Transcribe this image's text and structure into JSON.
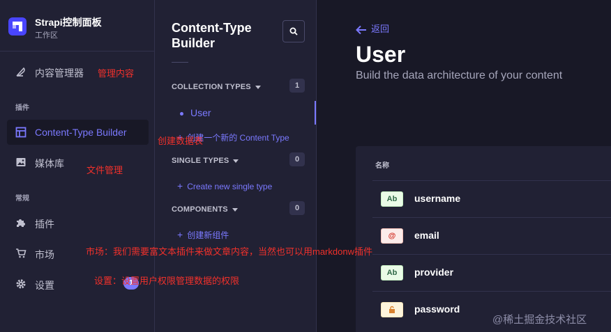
{
  "brand": {
    "title": "Strapi控制面板",
    "subtitle": "工作区"
  },
  "nav": {
    "content_manager": "内容管理器",
    "section_plugins": "插件",
    "content_type_builder": "Content-Type Builder",
    "media_library": "媒体库",
    "section_general": "常规",
    "plugins": "插件",
    "marketplace": "市场",
    "settings": "设置",
    "settings_badge": "1"
  },
  "builder": {
    "title": "Content-Type Builder",
    "collection_types": {
      "label": "COLLECTION TYPES",
      "count": "1",
      "items": [
        "User"
      ],
      "add": "创建一个新的 Content Type"
    },
    "single_types": {
      "label": "SINGLE TYPES",
      "count": "0",
      "add": "Create new single type"
    },
    "components": {
      "label": "COMPONENTS",
      "count": "0",
      "add": "创建新组件"
    }
  },
  "main": {
    "back": "返回",
    "title": "User",
    "subtitle": "Build the data architecture of your content",
    "table_header": "名称",
    "fields": [
      {
        "icon": "Ab",
        "name": "username",
        "bg": "#eafbe7",
        "border": "#c6f0c2",
        "color": "#2f6846"
      },
      {
        "icon": "@",
        "name": "email",
        "bg": "#fcecea",
        "border": "#f5c0b8",
        "color": "#d02b20"
      },
      {
        "icon": "Ab",
        "name": "provider",
        "bg": "#eafbe7",
        "border": "#c6f0c2",
        "color": "#2f6846"
      },
      {
        "icon": "lock-icon",
        "name": "password",
        "bg": "#fdf4dc",
        "border": "#fae7b9",
        "color": "#d9822f"
      }
    ]
  },
  "annotations": {
    "content_manager": "管理内容",
    "ctb": "创建数据表",
    "media": "文件管理",
    "market": "市场：我们需要富文本插件来做文章内容，当然也可以用markdonw插件",
    "settings": "设置：设置用户权限管理数据的权限"
  },
  "watermark": "@稀土掘金技术社区",
  "colors": {
    "primary": "#7b79ff",
    "brand": "#4945ff",
    "annotation": "#f0312b"
  }
}
